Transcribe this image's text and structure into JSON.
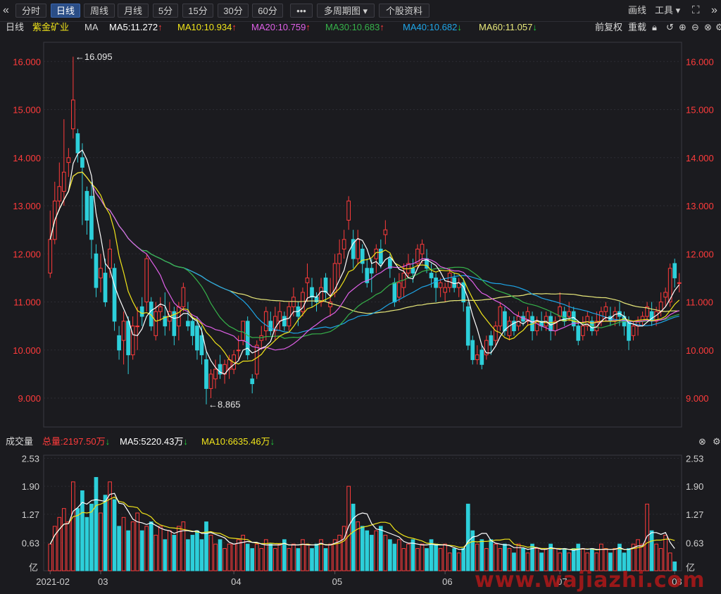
{
  "toolbar": {
    "collapse_left": "«",
    "collapse_right": "»",
    "tabs": [
      "分时",
      "日线",
      "周线",
      "月线",
      "5分",
      "15分",
      "30分",
      "60分",
      "•••",
      "多周期图 ▾",
      "个股资料"
    ],
    "active_tab": "日线",
    "draw_label": "画线",
    "tools_label": "工具 ▾",
    "fullscreen_icon": "expand-icon"
  },
  "infobar": {
    "period": "日线",
    "stock_name": "紫金矿业",
    "ma_label": "MA",
    "ma_values": [
      {
        "text": "MA5:11.272",
        "arrow": "↑",
        "color": "#ffffff"
      },
      {
        "text": "MA10:10.934",
        "arrow": "↑",
        "color": "#f0e41a"
      },
      {
        "text": "MA20:10.759",
        "arrow": "↑",
        "color": "#e060e8"
      },
      {
        "text": "MA30:10.683",
        "arrow": "↑",
        "color": "#36b24a"
      },
      {
        "text": "MA40:10.682",
        "arrow": "↓",
        "color": "#1ea6e8"
      },
      {
        "text": "MA60:11.057",
        "arrow": "↓",
        "color": "#e8e87a"
      }
    ],
    "adjust_label": "前复权",
    "reload_label": "重载"
  },
  "volume_bar": {
    "title": "成交量",
    "total": "总量:2197.50万",
    "total_arrow": "↓",
    "ma5": "MA5:5220.43万",
    "ma5_arrow": "↓",
    "ma10": "MA10:6635.46万",
    "ma10_arrow": "↓"
  },
  "watermark": "www.wajiazhi.com",
  "colors": {
    "up": "#ff3b3b",
    "down": "#2dcfda",
    "ma5": "#ffffff",
    "ma10": "#f0e41a",
    "ma20": "#e060e8",
    "ma30": "#36b24a",
    "ma40": "#1ea6e8",
    "ma60": "#e8e87a",
    "axis_label": "#ff3b3b"
  },
  "chart_data": {
    "type": "candlestick",
    "price_axis": {
      "ticks": [
        9.0,
        10.0,
        11.0,
        12.0,
        13.0,
        14.0,
        15.0,
        16.0
      ],
      "tick_labels": [
        "9.000",
        "10.000",
        "11.000",
        "12.000",
        "13.000",
        "14.000",
        "15.000",
        "16.000"
      ],
      "ylim": [
        8.4,
        16.4
      ]
    },
    "volume_axis": {
      "ticks": [
        0.63,
        1.27,
        1.9,
        2.53
      ],
      "tick_labels": [
        "0.63",
        "1.27",
        "1.90",
        "2.53"
      ],
      "unit": "亿",
      "ylim": [
        0,
        2.6
      ]
    },
    "x_labels": [
      {
        "label": "2021-02",
        "index": 0
      },
      {
        "label": "03",
        "index": 11
      },
      {
        "label": "04",
        "index": 40
      },
      {
        "label": "05",
        "index": 62
      },
      {
        "label": "06",
        "index": 86
      },
      {
        "label": "07",
        "index": 111
      },
      {
        "label": "08",
        "index": 136
      }
    ],
    "annotations": [
      {
        "text": "16.095",
        "index": 5,
        "value": 16.095,
        "kind": "high"
      },
      {
        "text": "8.865",
        "index": 34,
        "value": 8.865,
        "kind": "low"
      }
    ],
    "ohlc": [
      [
        11.6,
        12.3,
        11.5,
        12.9
      ],
      [
        12.3,
        13.1,
        12.2,
        13.5
      ],
      [
        13.1,
        13.4,
        12.9,
        13.9
      ],
      [
        13.3,
        13.7,
        13.0,
        14.8
      ],
      [
        13.9,
        14.0,
        13.6,
        14.2
      ],
      [
        14.6,
        15.2,
        14.4,
        16.1
      ],
      [
        14.5,
        14.1,
        13.9,
        14.6
      ],
      [
        14.0,
        13.8,
        12.6,
        14.3
      ],
      [
        13.3,
        12.7,
        12.4,
        13.4
      ],
      [
        13.2,
        12.3,
        11.9,
        13.5
      ],
      [
        12.0,
        11.3,
        11.1,
        12.2
      ],
      [
        11.5,
        11.7,
        11.2,
        12.0
      ],
      [
        11.6,
        11.0,
        10.9,
        11.9
      ],
      [
        11.7,
        12.1,
        11.5,
        12.3
      ],
      [
        11.7,
        10.6,
        10.4,
        11.8
      ],
      [
        10.3,
        10.0,
        9.8,
        10.5
      ],
      [
        10.2,
        10.6,
        9.7,
        10.8
      ],
      [
        10.6,
        9.9,
        9.5,
        10.7
      ],
      [
        9.9,
        10.5,
        9.8,
        10.7
      ],
      [
        10.5,
        10.5,
        10.0,
        10.9
      ],
      [
        10.9,
        10.7,
        10.5,
        11.1
      ],
      [
        11.0,
        11.9,
        10.8,
        12.0
      ],
      [
        11.0,
        10.5,
        10.4,
        11.1
      ],
      [
        10.3,
        10.8,
        10.2,
        11.0
      ],
      [
        10.8,
        10.9,
        10.6,
        11.1
      ],
      [
        10.7,
        10.5,
        10.3,
        11.2
      ],
      [
        10.6,
        10.8,
        10.4,
        11.0
      ],
      [
        10.8,
        10.3,
        10.1,
        10.9
      ],
      [
        10.5,
        10.9,
        10.2,
        11.0
      ],
      [
        10.9,
        11.3,
        10.8,
        11.4
      ],
      [
        10.6,
        10.5,
        10.4,
        11.0
      ],
      [
        10.6,
        10.3,
        10.1,
        10.7
      ],
      [
        10.5,
        10.0,
        9.8,
        10.7
      ],
      [
        10.3,
        9.9,
        9.7,
        10.5
      ],
      [
        9.8,
        9.2,
        8.87,
        10.0
      ],
      [
        9.2,
        9.5,
        9.0,
        9.6
      ],
      [
        9.4,
        9.6,
        9.2,
        9.8
      ],
      [
        9.7,
        9.5,
        9.4,
        9.9
      ],
      [
        9.5,
        9.7,
        9.3,
        9.8
      ],
      [
        9.6,
        9.8,
        9.4,
        9.9
      ],
      [
        9.6,
        9.9,
        9.5,
        10.0
      ],
      [
        10.0,
        10.0,
        9.8,
        10.3
      ],
      [
        10.2,
        10.6,
        10.1,
        10.6
      ],
      [
        10.6,
        9.9,
        9.8,
        10.7
      ],
      [
        9.4,
        9.3,
        9.1,
        9.5
      ],
      [
        9.5,
        10.1,
        9.4,
        10.2
      ],
      [
        10.2,
        10.3,
        10.0,
        10.5
      ],
      [
        10.4,
        10.8,
        10.2,
        10.9
      ],
      [
        10.6,
        10.4,
        10.3,
        10.8
      ],
      [
        10.4,
        10.7,
        10.2,
        10.9
      ],
      [
        10.6,
        10.8,
        10.4,
        11.0
      ],
      [
        10.7,
        10.5,
        10.4,
        10.8
      ],
      [
        10.5,
        10.9,
        10.4,
        11.0
      ],
      [
        10.9,
        11.1,
        10.7,
        11.3
      ],
      [
        10.9,
        10.7,
        10.5,
        11.0
      ],
      [
        10.8,
        11.2,
        10.7,
        11.3
      ],
      [
        11.4,
        11.5,
        11.0,
        11.8
      ],
      [
        11.3,
        11.1,
        10.9,
        11.5
      ],
      [
        11.1,
        11.0,
        10.8,
        11.2
      ],
      [
        11.0,
        11.3,
        10.9,
        11.5
      ],
      [
        11.5,
        11.2,
        11.0,
        11.6
      ],
      [
        10.9,
        11.0,
        10.7,
        11.5
      ],
      [
        11.2,
        11.8,
        11.1,
        12.0
      ],
      [
        11.8,
        12.0,
        11.5,
        12.3
      ],
      [
        12.1,
        12.3,
        11.9,
        12.5
      ],
      [
        12.7,
        13.1,
        12.5,
        13.2
      ],
      [
        12.3,
        11.9,
        11.7,
        12.5
      ],
      [
        11.9,
        12.3,
        11.8,
        12.5
      ],
      [
        12.1,
        11.8,
        11.6,
        12.2
      ],
      [
        11.7,
        11.4,
        11.3,
        11.9
      ],
      [
        11.7,
        11.6,
        11.2,
        11.9
      ],
      [
        11.9,
        12.1,
        11.6,
        12.2
      ],
      [
        12.1,
        11.8,
        11.7,
        12.3
      ],
      [
        12.4,
        12.5,
        12.2,
        12.7
      ],
      [
        11.9,
        11.7,
        11.5,
        12.0
      ],
      [
        11.4,
        11.0,
        10.9,
        11.5
      ],
      [
        11.1,
        11.4,
        11.0,
        11.6
      ],
      [
        11.3,
        11.6,
        11.1,
        11.8
      ],
      [
        11.6,
        11.8,
        11.5,
        12.0
      ],
      [
        11.7,
        11.6,
        11.4,
        11.9
      ],
      [
        11.8,
        12.1,
        11.7,
        12.2
      ],
      [
        12.0,
        12.2,
        11.8,
        12.3
      ],
      [
        11.9,
        11.7,
        11.6,
        12.1
      ],
      [
        11.6,
        11.5,
        11.3,
        11.8
      ],
      [
        11.5,
        11.3,
        11.0,
        11.6
      ],
      [
        11.3,
        11.4,
        11.1,
        11.5
      ],
      [
        11.2,
        11.3,
        11.0,
        11.4
      ],
      [
        11.3,
        11.6,
        11.2,
        11.7
      ],
      [
        11.5,
        11.3,
        11.2,
        11.6
      ],
      [
        11.3,
        11.4,
        11.1,
        11.5
      ],
      [
        11.4,
        11.0,
        10.8,
        11.5
      ],
      [
        10.9,
        10.1,
        10.0,
        11.0
      ],
      [
        10.2,
        9.8,
        9.7,
        10.3
      ],
      [
        9.8,
        9.9,
        9.7,
        10.1
      ],
      [
        10.0,
        9.7,
        9.6,
        10.1
      ],
      [
        9.9,
        10.2,
        9.8,
        10.3
      ],
      [
        10.3,
        10.1,
        9.9,
        10.4
      ],
      [
        10.2,
        10.5,
        10.1,
        10.6
      ],
      [
        10.5,
        10.9,
        10.4,
        11.0
      ],
      [
        10.8,
        10.4,
        10.3,
        10.9
      ],
      [
        10.3,
        10.6,
        10.2,
        10.7
      ],
      [
        10.6,
        10.4,
        10.3,
        10.7
      ],
      [
        10.5,
        10.7,
        10.4,
        10.8
      ],
      [
        10.7,
        10.6,
        10.5,
        10.8
      ],
      [
        10.6,
        10.8,
        10.5,
        10.9
      ],
      [
        10.7,
        10.4,
        10.2,
        10.8
      ],
      [
        10.4,
        10.6,
        10.3,
        10.7
      ],
      [
        10.6,
        10.5,
        10.4,
        10.8
      ],
      [
        10.5,
        10.7,
        10.4,
        10.8
      ],
      [
        10.7,
        10.4,
        10.2,
        10.8
      ],
      [
        10.4,
        10.6,
        10.3,
        10.7
      ],
      [
        10.7,
        10.9,
        10.6,
        11.2
      ],
      [
        10.8,
        10.6,
        10.5,
        10.9
      ],
      [
        10.7,
        10.8,
        10.6,
        11.0
      ],
      [
        10.8,
        10.5,
        10.4,
        10.9
      ],
      [
        10.5,
        10.2,
        10.1,
        10.6
      ],
      [
        10.3,
        10.5,
        10.2,
        10.7
      ],
      [
        10.5,
        10.7,
        10.4,
        10.8
      ],
      [
        10.6,
        10.4,
        10.3,
        10.7
      ],
      [
        10.4,
        10.6,
        10.3,
        10.8
      ],
      [
        10.6,
        10.8,
        10.5,
        10.9
      ],
      [
        10.8,
        10.9,
        10.6,
        11.0
      ],
      [
        10.7,
        10.6,
        10.5,
        10.9
      ],
      [
        10.6,
        10.8,
        10.5,
        10.9
      ],
      [
        10.8,
        10.7,
        10.5,
        11.0
      ],
      [
        10.7,
        10.5,
        10.3,
        10.8
      ],
      [
        10.6,
        10.2,
        10.0,
        10.7
      ],
      [
        10.3,
        10.5,
        10.2,
        10.6
      ],
      [
        10.5,
        10.6,
        10.3,
        10.7
      ],
      [
        10.6,
        10.7,
        10.5,
        10.8
      ],
      [
        10.7,
        10.9,
        10.6,
        11.0
      ],
      [
        10.8,
        10.6,
        10.5,
        11.0
      ],
      [
        10.6,
        10.8,
        10.5,
        10.9
      ],
      [
        10.8,
        11.0,
        10.7,
        11.2
      ],
      [
        11.1,
        11.2,
        10.9,
        11.3
      ],
      [
        11.0,
        11.7,
        10.9,
        11.8
      ],
      [
        11.8,
        11.5,
        11.3,
        11.9
      ],
      [
        11.4,
        11.4,
        11.2,
        11.6
      ]
    ],
    "volume": [
      0.6,
      1.0,
      1.2,
      1.4,
      1.1,
      2.0,
      1.4,
      1.8,
      1.2,
      1.5,
      2.1,
      1.3,
      1.7,
      2.0,
      1.6,
      1.0,
      1.2,
      0.9,
      1.1,
      1.3,
      0.9,
      1.0,
      1.1,
      0.8,
      1.0,
      0.7,
      0.9,
      0.8,
      1.0,
      1.1,
      0.7,
      0.8,
      0.9,
      0.7,
      1.1,
      0.8,
      0.6,
      0.7,
      0.5,
      0.6,
      0.6,
      0.7,
      0.8,
      0.6,
      0.5,
      0.6,
      0.5,
      0.7,
      0.6,
      0.5,
      0.6,
      0.7,
      0.5,
      0.6,
      0.5,
      0.7,
      0.6,
      0.5,
      0.6,
      0.7,
      0.5,
      0.6,
      0.7,
      0.8,
      1.0,
      1.9,
      1.5,
      1.1,
      1.0,
      0.9,
      0.8,
      0.9,
      1.0,
      0.8,
      0.7,
      0.6,
      0.7,
      0.5,
      0.6,
      0.7,
      0.5,
      0.6,
      0.5,
      0.7,
      0.6,
      0.5,
      0.6,
      0.4,
      0.5,
      0.4,
      0.5,
      1.5,
      0.9,
      0.6,
      0.7,
      0.5,
      0.7,
      0.6,
      0.5,
      0.6,
      0.5,
      0.4,
      0.6,
      0.5,
      0.4,
      0.6,
      0.5,
      0.4,
      0.5,
      0.6,
      0.5,
      0.4,
      0.5,
      0.4,
      0.5,
      0.6,
      0.5,
      0.4,
      0.5,
      0.4,
      0.6,
      0.5,
      0.4,
      0.5,
      0.6,
      0.4,
      0.5,
      0.6,
      0.7,
      0.6,
      1.5,
      0.9,
      0.6,
      0.5,
      0.8,
      0.4,
      0.2
    ]
  }
}
